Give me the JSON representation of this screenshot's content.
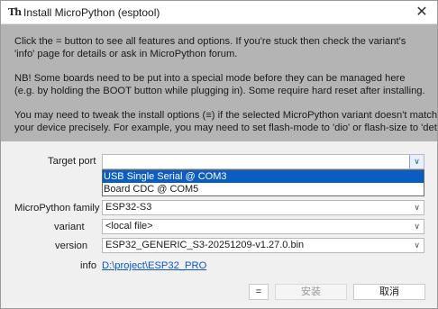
{
  "window": {
    "title": "Install MicroPython (esptool)",
    "icon_text": "Th",
    "close_glyph": "✕"
  },
  "info": {
    "paragraphs": [
      [
        "Click the = button to see all features and options. If you're stuck then check the variant's",
        "'info' page for details or ask in MicroPython forum."
      ],
      [
        "NB! Some boards need to be put into a special mode before they can be managed here",
        "(e.g. by holding the BOOT button while plugging in). Some require hard reset after installing."
      ],
      [
        "You may need to tweak the install options (≡) if the selected MicroPython variant doesn't match",
        "your device precisely. For example, you may need to set flash-mode to 'dio' or flash-size to 'detect'."
      ]
    ]
  },
  "form": {
    "target_port_label": "Target port",
    "target_port_value": "",
    "port_options": [
      "USB Single Serial @ COM3",
      "Board CDC @ COM5"
    ],
    "family_label": "MicroPython family",
    "family_value": "ESP32-S3",
    "variant_label": "variant",
    "variant_value": "<local file>",
    "version_label": "version",
    "version_value": "ESP32_GENERIC_S3-20251209-v1.27.0.bin",
    "info_label": "info",
    "info_link": "D:\\project\\ESP32_PRO"
  },
  "buttons": {
    "features": "=",
    "install": "安装",
    "cancel": "取消"
  },
  "colors": {
    "info_panel_bg": "#b4b4b4",
    "selection": "#0a5dc2",
    "link": "#0b57d0"
  },
  "icons": {
    "chevron": "chevron-down-icon",
    "close": "close-icon"
  }
}
